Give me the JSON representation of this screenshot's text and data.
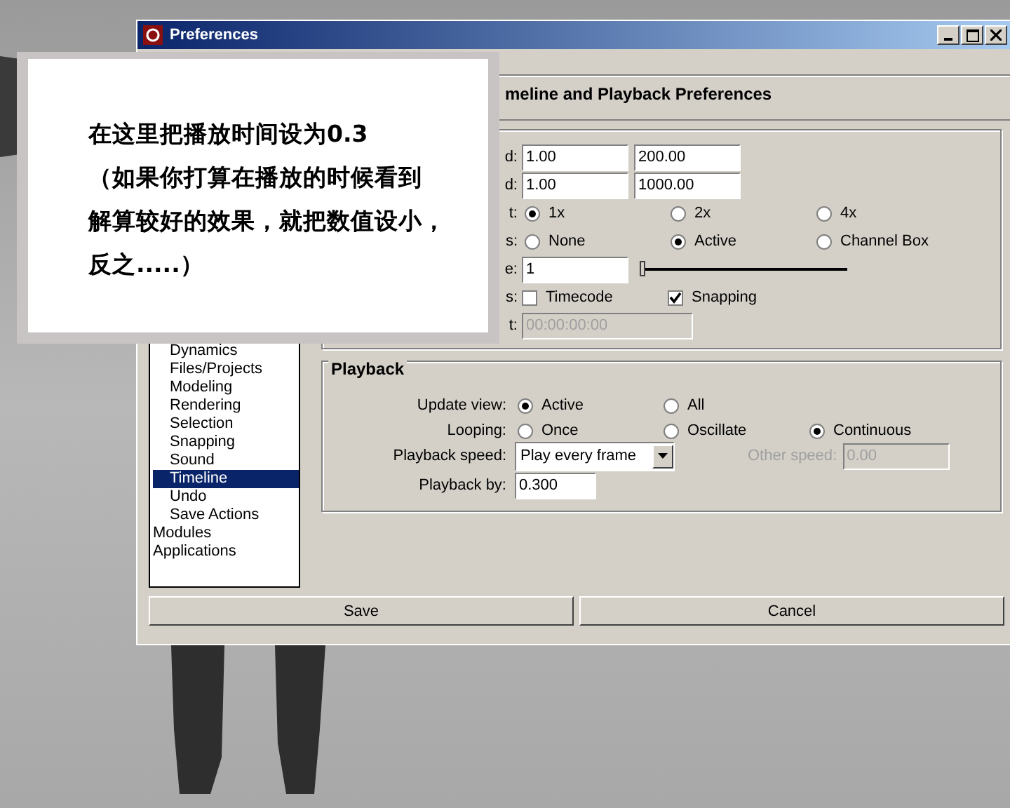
{
  "window": {
    "title": "Preferences"
  },
  "header": "meline and Playback Preferences",
  "categories": [
    {
      "children": [
        {
          "label": "Dynamics",
          "selected": false
        },
        {
          "label": "Files/Projects",
          "selected": false
        },
        {
          "label": "Modeling",
          "selected": false
        },
        {
          "label": "Rendering",
          "selected": false
        },
        {
          "label": "Selection",
          "selected": false
        },
        {
          "label": "Snapping",
          "selected": false
        },
        {
          "label": "Sound",
          "selected": false
        },
        {
          "label": "Timeline",
          "selected": true
        },
        {
          "label": "Undo",
          "selected": false
        },
        {
          "label": "Save Actions",
          "selected": false
        }
      ]
    },
    {
      "label": "Modules",
      "selected": false
    },
    {
      "label": "Applications",
      "selected": false
    }
  ],
  "timeline_rows": [
    {
      "kind": "fields",
      "label": "d:",
      "values": [
        "1.00",
        "200.00"
      ]
    },
    {
      "kind": "fields",
      "label": "d:",
      "values": [
        "1.00",
        "1000.00"
      ]
    },
    {
      "kind": "radios",
      "label": "t:",
      "options": [
        {
          "label": "1x",
          "selected": true
        },
        {
          "label": "2x",
          "selected": false
        },
        {
          "label": "4x",
          "selected": false
        }
      ]
    },
    {
      "kind": "radios",
      "label": "s:",
      "options": [
        {
          "label": "None",
          "selected": false
        },
        {
          "label": "Active",
          "selected": true
        },
        {
          "label": "Channel Box",
          "selected": false
        }
      ]
    },
    {
      "kind": "slider",
      "label": "e:",
      "value": "1",
      "level": 0
    },
    {
      "kind": "checks",
      "label": "s:",
      "options": [
        {
          "label": "Timecode",
          "checked": false
        },
        {
          "label": "Snapping",
          "checked": true
        }
      ]
    },
    {
      "kind": "field",
      "label": "t:",
      "value": "00:00:00:00",
      "disabled": true
    }
  ],
  "playback": {
    "title": "Playback",
    "rows": [
      {
        "kind": "radios",
        "label": "Update view:",
        "options": [
          {
            "label": "Active",
            "selected": true
          },
          {
            "label": "All",
            "selected": false
          }
        ]
      },
      {
        "kind": "radios",
        "label": "Looping:",
        "options": [
          {
            "label": "Once",
            "selected": false
          },
          {
            "label": "Oscillate",
            "selected": false
          },
          {
            "label": "Continuous",
            "selected": true
          }
        ]
      },
      {
        "kind": "dropdown",
        "label": "Playback speed:",
        "value": "Play every frame",
        "other_label": "Other speed:",
        "other_value": "0.00",
        "other_disabled": true
      },
      {
        "kind": "field",
        "label": "Playback by:",
        "value": "0.300",
        "disabled": false
      }
    ]
  },
  "buttons": [
    "Save",
    "Cancel"
  ],
  "callout": [
    "在这里把播放时间设为0.3",
    "（如果你打算在播放的时候看到",
    "解算较好的效果，就把数值设小，",
    "反之.....）"
  ]
}
